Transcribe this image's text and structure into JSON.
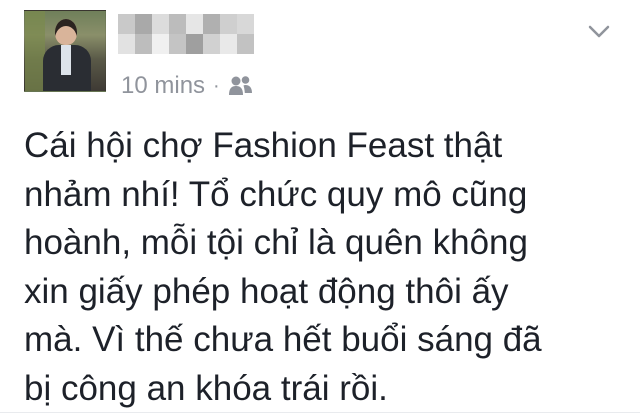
{
  "post": {
    "author": {
      "name": "",
      "name_obscured": true
    },
    "timestamp": "10 mins",
    "separator": "·",
    "audience_icon": "friends-icon",
    "menu_icon": "chevron-down-icon",
    "body": "Cái hội chợ Fashion Feast thật\nnhảm nhí! Tổ chức quy mô cũng\nhoành, mỗi tội chỉ là quên không\nxin giấy phép hoạt động thôi ấy\nmà. Vì thế chưa hết buổi sáng đã\nbị công an khóa trái rồi."
  },
  "colors": {
    "text": "#1d2129",
    "meta": "#90949c",
    "background": "#ffffff"
  }
}
